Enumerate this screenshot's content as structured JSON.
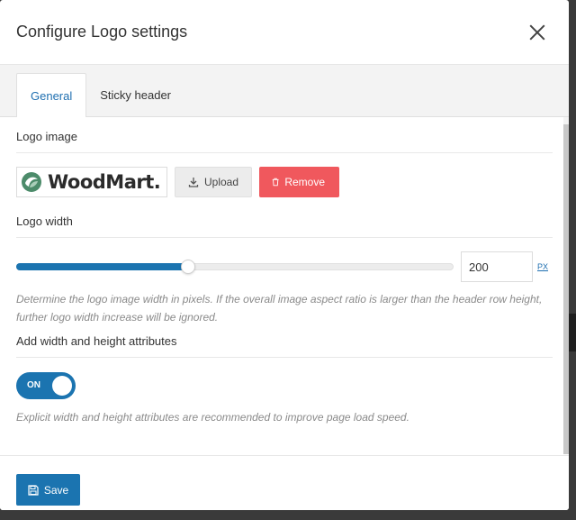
{
  "dialog": {
    "title": "Configure Logo settings"
  },
  "tabs": [
    {
      "label": "General",
      "active": true
    },
    {
      "label": "Sticky header",
      "active": false
    }
  ],
  "logo_image": {
    "label": "Logo image",
    "logo_text": "WoodMart.",
    "upload_label": "Upload",
    "remove_label": "Remove"
  },
  "logo_width": {
    "label": "Logo width",
    "value": "200",
    "unit": "PX",
    "slider_fraction": 0.39,
    "hint": "Determine the logo image width in pixels. If the overall image aspect ratio is larger than the header row height, further logo width increase will be ignored."
  },
  "attributes": {
    "label": "Add width and height attributes",
    "toggle_label": "ON",
    "toggle_on": true,
    "hint": "Explicit width and height attributes are recommended to improve page load speed."
  },
  "footer": {
    "save_label": "Save"
  },
  "colors": {
    "accent": "#1b74b0",
    "remove": "#f0585d",
    "logo_green": "#4c8b6a"
  },
  "icons": {
    "close": "close-icon",
    "upload": "download-arrow-icon",
    "remove": "trash-icon",
    "save": "floppy-disk-icon",
    "logo": "woodmart-logo-icon"
  }
}
